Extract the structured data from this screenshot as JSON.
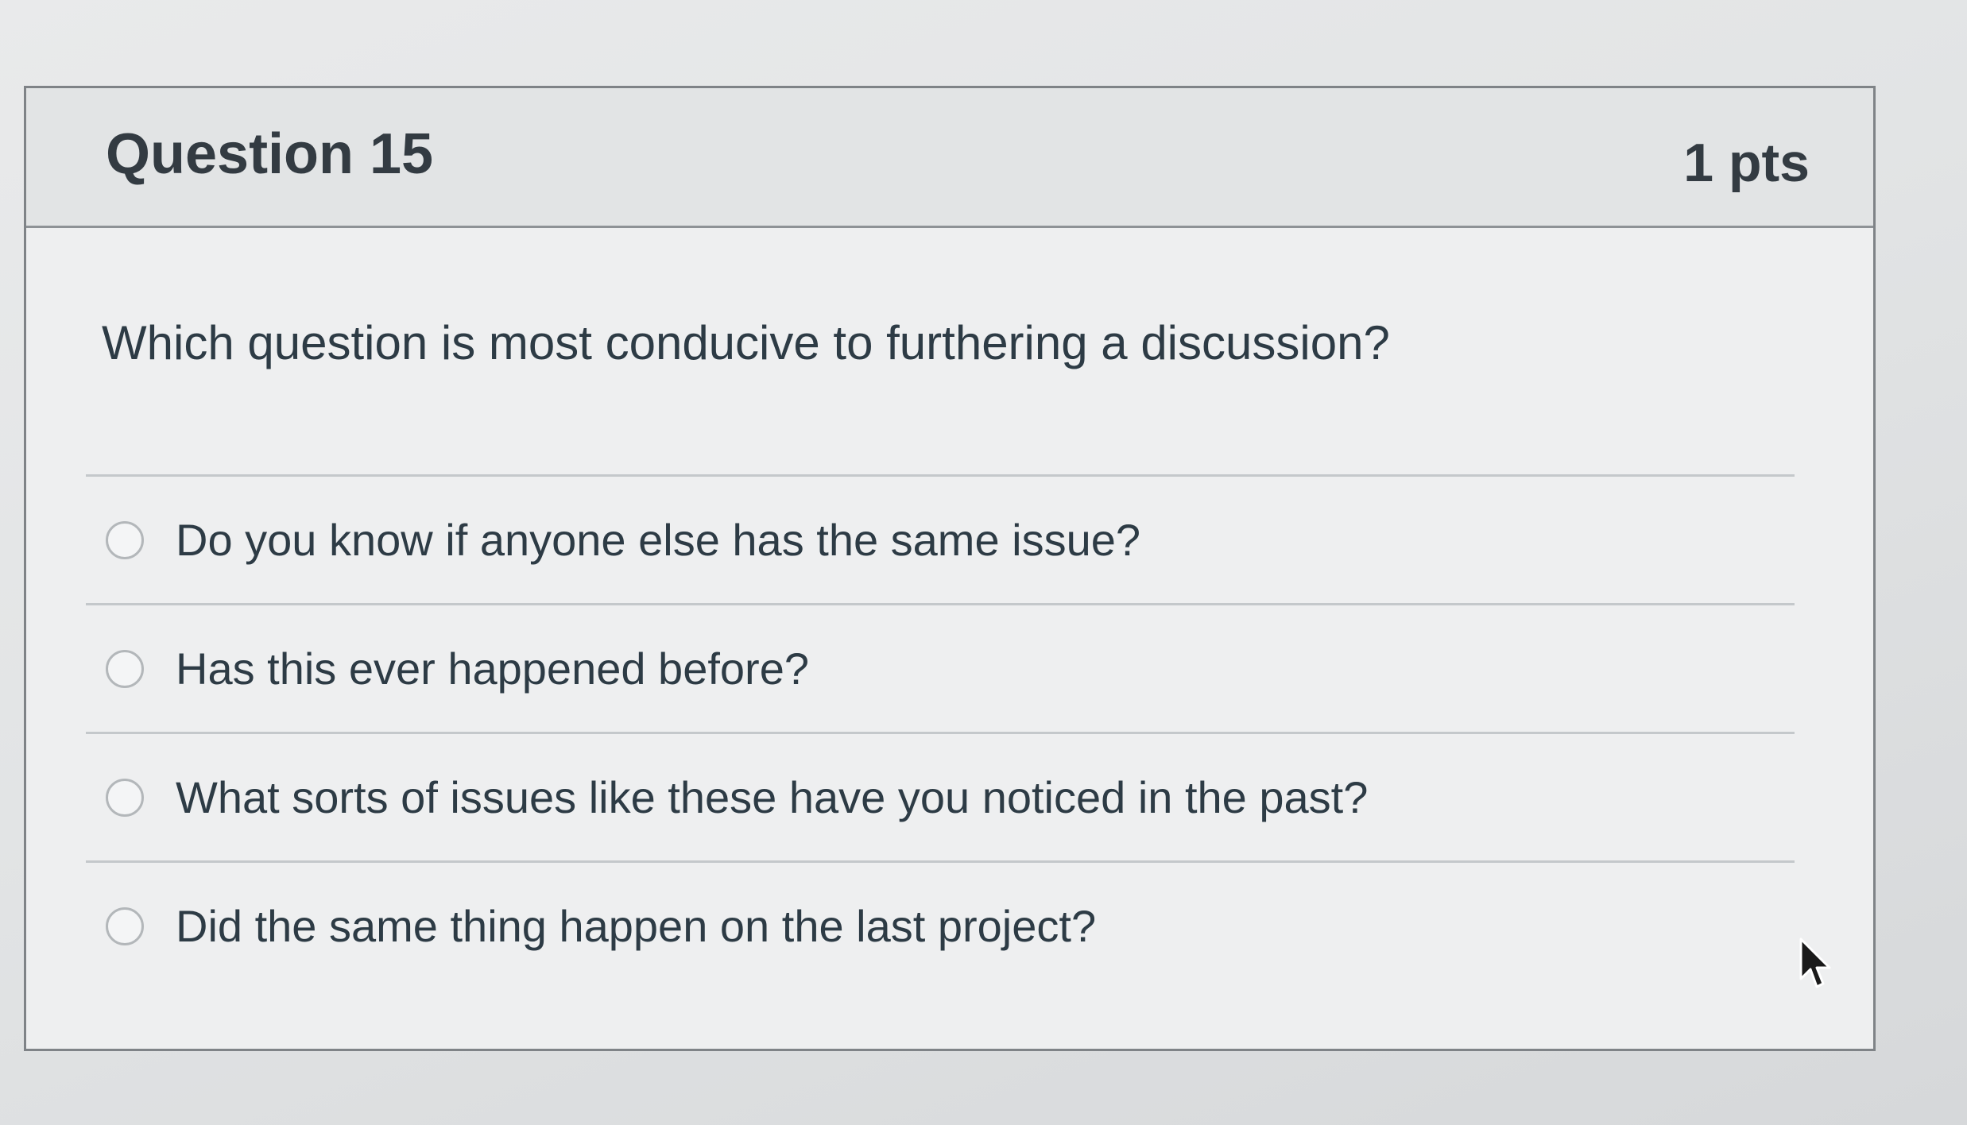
{
  "question": {
    "title": "Question 15",
    "points": "1 pts",
    "prompt": "Which question is most conducive to furthering a discussion?",
    "answers": [
      {
        "label": "Do you know if anyone else has the same issue?",
        "selected": false
      },
      {
        "label": "Has this ever happened before?",
        "selected": false
      },
      {
        "label": "What sorts of issues like these have you noticed in the past?",
        "selected": false
      },
      {
        "label": "Did the same thing happen on the last project?",
        "selected": false
      }
    ]
  },
  "icons": {
    "radio": "radio-button-icon",
    "cursor": "mouse-pointer-icon"
  },
  "colors": {
    "text": "#2d3b45",
    "border": "#7f8387",
    "header_bg": "#e2e4e5"
  }
}
